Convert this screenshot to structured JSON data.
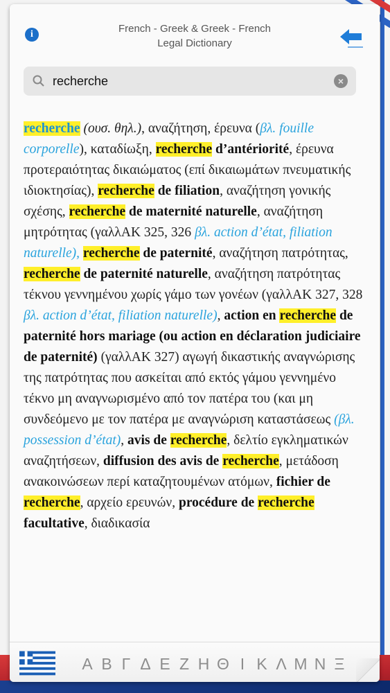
{
  "header": {
    "title_line1": "French - Greek & Greek - French",
    "title_line2": "Legal Dictionary",
    "info_icon": "info-icon",
    "back_icon": "back-arrow-icon"
  },
  "search": {
    "value": "recherche",
    "search_icon": "search-icon",
    "clear_icon": "clear-icon"
  },
  "entry": {
    "t1": "recherche",
    "t2": " (ουσ. θηλ.)",
    "t3": ", αναζήτηση, έρευνα (",
    "t4": "βλ. fouille corporelle",
    "t5": "), καταδίωξη, ",
    "t6": "recherche",
    "t7": " d’antériorité",
    "t8": ", έρευνα προτεραιότητας δικαιώματος (επί δικαιωμάτων πνευματικής ιδιοκτησίας), ",
    "t9": "recherche",
    "t10": " de filiation",
    "t11": ", αναζήτηση γονικής σχέσης, ",
    "t12": "recherche",
    "t13": " de maternité naturelle",
    "t14": ", αναζήτηση μητρότητας (γαλλΑΚ 325, 326 ",
    "t15": "βλ. action d’état, filiation naturelle),",
    "t16": " ",
    "t17": "recherche",
    "t18": " de paternité",
    "t19": ", αναζήτηση πατρότητας, ",
    "t20": "recherche",
    "t21": " de paternité naturelle",
    "t22": ", αναζήτηση πατρότητας τέκνου γεννημένου χωρίς γάμο των γονέων (γαλλΑΚ 327, 328 ",
    "t23": "βλ. action d’état, filiation naturelle)",
    "t24": ", ",
    "t25": "action en ",
    "t26": "recherche",
    "t27": " de paternité hors mariage (ou action en déclaration judiciaire de paternité)",
    "t28": " (γαλλΑΚ 327) αγωγή δικαστικής αναγνώρισης της πατρότητας που ασκείται από εκτός γάμου γεννημένο τέκνο μη αναγνωρισμένο από τον πατέρα του (και μη συνδεόμενο με τον πατέρα με αναγνώριση καταστάσεως ",
    "t29": "(βλ. possession d’état)",
    "t30": ", ",
    "t31": "avis de ",
    "t32": "recherche",
    "t33": ", δελτίο εγκληματικών αναζητήσεων, ",
    "t34": "diffusion des avis de ",
    "t35": "recherche",
    "t36": ", μετάδοση ανακοινώσεων περί καταζητουμένων ατόμων, ",
    "t37": "fichier de ",
    "t38": "recherche",
    "t39": ", αρχείο ερευνών, ",
    "t40": "procédure de ",
    "t41": "recherche",
    "t42": " facultative",
    "t43": ", διαδικασία"
  },
  "footer": {
    "flag_icon": "greek-flag-icon",
    "letters": [
      "Α",
      "Β",
      "Γ",
      "Δ",
      "Ε",
      "Ζ",
      "Η",
      "Θ",
      "Ι",
      "Κ",
      "Λ",
      "Μ",
      "Ν",
      "Ξ"
    ]
  },
  "colors": {
    "highlight": "#ffef2a",
    "reference": "#2aa3dd",
    "headword": "#1f94d1",
    "greek_blue": "#1b5fb5"
  }
}
